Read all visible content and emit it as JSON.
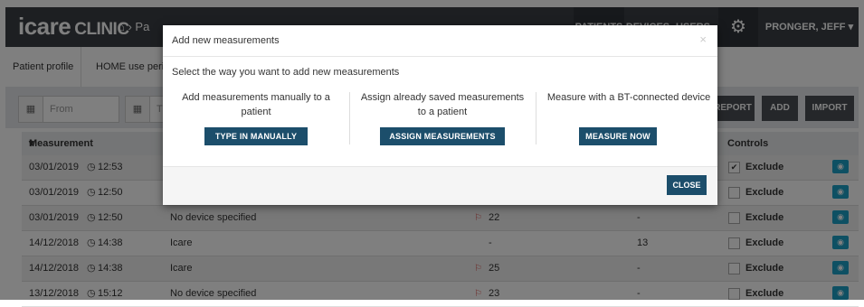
{
  "header": {
    "logo_main": "icare",
    "logo_sub": "CLINIC",
    "home_crumb": "Pa",
    "nav": [
      "PATIENTS",
      "DEVICES",
      "USERS"
    ],
    "user_menu": "PRONGER, JEFF"
  },
  "tabs": [
    "Patient profile",
    "HOME use perio"
  ],
  "filters": {
    "from_placeholder": "From",
    "to_placeholder": "T",
    "report": "REPORT",
    "add": "ADD",
    "import": "IMPORT"
  },
  "table": {
    "col_time": "Measurement time",
    "col_controls": "Controls",
    "exclude_label": "Exclude",
    "rows": [
      {
        "time": "03/01/2019",
        "clock": "12:53",
        "device": "",
        "v1": "",
        "v2": "",
        "checked": true
      },
      {
        "time": "03/01/2019",
        "clock": "12:50",
        "device": "",
        "v1": "",
        "v2": "",
        "checked": false
      },
      {
        "time": "03/01/2019",
        "clock": "12:50",
        "device": "No device specified",
        "v1": "22",
        "v2": "-",
        "checked": false,
        "flag": true
      },
      {
        "time": "14/12/2018",
        "clock": "14:38",
        "device": "Icare",
        "v1": "-",
        "v2": "13",
        "checked": false,
        "flag": false
      },
      {
        "time": "14/12/2018",
        "clock": "14:38",
        "device": "Icare",
        "v1": "25",
        "v2": "-",
        "checked": false,
        "flag": true
      },
      {
        "time": "13/12/2018",
        "clock": "15:12",
        "device": "No device specified",
        "v1": "23",
        "v2": "-",
        "checked": false,
        "flag": true
      }
    ]
  },
  "modal": {
    "title": "Add new measurements",
    "intro": "Select the way you want to add new measurements",
    "options": [
      {
        "desc": "Add measurements manually to a patient",
        "button": "TYPE IN MANUALLY"
      },
      {
        "desc": "Assign already saved measurements to a patient",
        "button": "ASSIGN MEASUREMENTS"
      },
      {
        "desc": "Measure with a BT-connected device",
        "button": "MEASURE NOW"
      }
    ],
    "close": "CLOSE",
    "close_x": "×"
  }
}
